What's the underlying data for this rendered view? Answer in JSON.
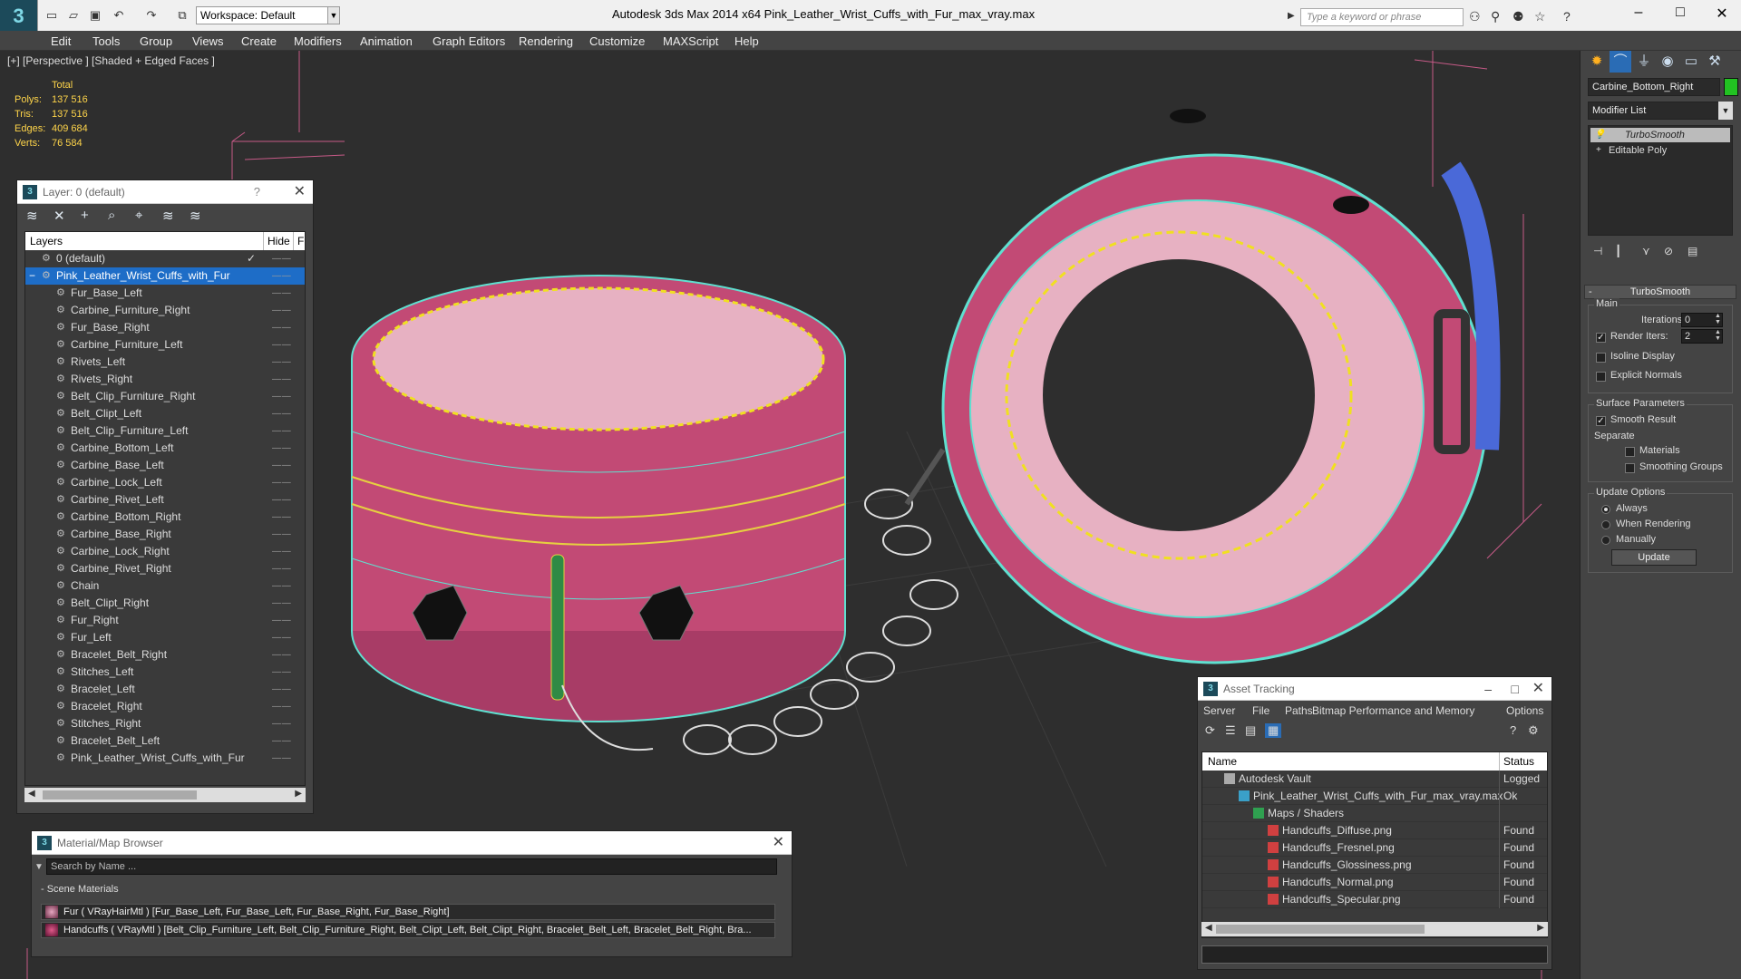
{
  "window": {
    "title": "Autodesk 3ds Max  2014 x64     Pink_Leather_Wrist_Cuffs_with_Fur_max_vray.max",
    "workspace": "Workspace: Default",
    "search_placeholder": "Type a keyword or phrase"
  },
  "menu": [
    "Edit",
    "Tools",
    "Group",
    "Views",
    "Create",
    "Modifiers",
    "Animation",
    "Graph Editors",
    "Rendering",
    "Customize",
    "MAXScript",
    "Help"
  ],
  "viewport": {
    "label": "[+] [Perspective ] [Shaded + Edged Faces ]",
    "stats": {
      "header": "Total",
      "rows": [
        {
          "k": "Polys:",
          "v": "137 516"
        },
        {
          "k": "Tris:",
          "v": "137 516"
        },
        {
          "k": "Edges:",
          "v": "409 684"
        },
        {
          "k": "Verts:",
          "v": "76 584"
        }
      ]
    }
  },
  "layer_panel": {
    "title": "Layer: 0 (default)",
    "help": "?",
    "col_layers": "Layers",
    "col_hide": "Hide",
    "col_f": "F",
    "root0": "0 (default)",
    "root1": "Pink_Leather_Wrist_Cuffs_with_Fur",
    "items": [
      "Fur_Base_Left",
      "Carbine_Furniture_Right",
      "Fur_Base_Right",
      "Carbine_Furniture_Left",
      "Rivets_Left",
      "Rivets_Right",
      "Belt_Clip_Furniture_Right",
      "Belt_Clipt_Left",
      "Belt_Clip_Furniture_Left",
      "Carbine_Bottom_Left",
      "Carbine_Base_Left",
      "Carbine_Lock_Left",
      "Carbine_Rivet_Left",
      "Carbine_Bottom_Right",
      "Carbine_Base_Right",
      "Carbine_Lock_Right",
      "Carbine_Rivet_Right",
      "Chain",
      "Belt_Clipt_Right",
      "Fur_Right",
      "Fur_Left",
      "Bracelet_Belt_Right",
      "Stitches_Left",
      "Bracelet_Left",
      "Bracelet_Right",
      "Stitches_Right",
      "Bracelet_Belt_Left",
      "Pink_Leather_Wrist_Cuffs_with_Fur"
    ]
  },
  "material_browser": {
    "title": "Material/Map Browser",
    "search_placeholder": "Search by Name ...",
    "group": "- Scene Materials",
    "materials": [
      "Fur  ( VRayHairMtl )  [Fur_Base_Left, Fur_Base_Left, Fur_Base_Right, Fur_Base_Right]",
      "Handcuffs  ( VRayMtl )  [Belt_Clip_Furniture_Left, Belt_Clip_Furniture_Right, Belt_Clipt_Left, Belt_Clipt_Right, Bracelet_Belt_Left, Bracelet_Belt_Right, Bra..."
    ]
  },
  "asset_tracking": {
    "title": "Asset Tracking",
    "menu": [
      "Server",
      "File",
      "Paths",
      "Bitmap Performance and Memory",
      "Options"
    ],
    "col_name": "Name",
    "col_status": "Status",
    "rows": [
      {
        "name": "Autodesk Vault",
        "status": "Logged",
        "indent": 0,
        "icon": "vault"
      },
      {
        "name": "Pink_Leather_Wrist_Cuffs_with_Fur_max_vray.max",
        "status": "Ok",
        "indent": 1,
        "icon": "max"
      },
      {
        "name": "Maps / Shaders",
        "status": "",
        "indent": 2,
        "icon": "maps"
      },
      {
        "name": "Handcuffs_Diffuse.png",
        "status": "Found",
        "indent": 3,
        "icon": "png"
      },
      {
        "name": "Handcuffs_Fresnel.png",
        "status": "Found",
        "indent": 3,
        "icon": "png"
      },
      {
        "name": "Handcuffs_Glossiness.png",
        "status": "Found",
        "indent": 3,
        "icon": "png"
      },
      {
        "name": "Handcuffs_Normal.png",
        "status": "Found",
        "indent": 3,
        "icon": "png"
      },
      {
        "name": "Handcuffs_Specular.png",
        "status": "Found",
        "indent": 3,
        "icon": "png"
      }
    ]
  },
  "command_panel": {
    "object_name": "Carbine_Bottom_Right",
    "object_color": "#22c222",
    "modifier_list": "Modifier List",
    "stack": [
      "TurboSmooth",
      "Editable Poly"
    ],
    "rollout": "TurboSmooth",
    "rollout_collapse": "-",
    "main_label": "Main",
    "iterations_label": "Iterations:",
    "iterations": "0",
    "render_iters_label": "Render Iters:",
    "render_iters": "2",
    "isoline": "Isoline Display",
    "explicit": "Explicit Normals",
    "surface_label": "Surface Parameters",
    "smooth_result": "Smooth Result",
    "separate_label": "Separate",
    "materials": "Materials",
    "smoothing_groups": "Smoothing Groups",
    "update_label": "Update Options",
    "always": "Always",
    "when_rendering": "When Rendering",
    "manually": "Manually",
    "update_button": "Update"
  }
}
